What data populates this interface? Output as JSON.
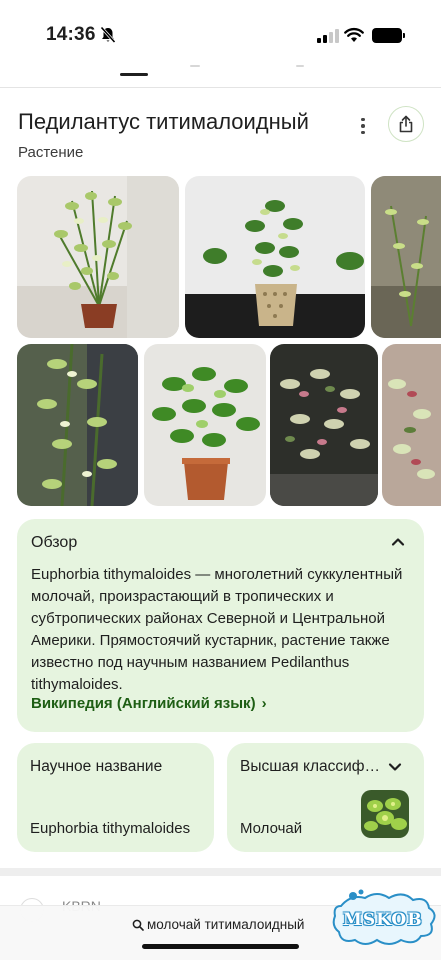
{
  "status_bar": {
    "time": "14:36",
    "accent": "#000000"
  },
  "knowledge_panel": {
    "title": "Педилантус титималоидный",
    "subtitle": "Растение",
    "more_icon": "more-vert-icon",
    "share_icon": "share-icon",
    "photos_count_visible": 9
  },
  "overview": {
    "heading": "Обзор",
    "text": "Euphorbia tithymaloides — многолетний суккулентный молочай, произрастающий в тропических и субтропических районах Северной и Центральной Америки. Прямостоячий кустарник, растение также известно под научным названием Pedilanthus tithymaloides.",
    "source_link": "Википедия (Английский язык)",
    "source_arrow": "›",
    "card_color": "#e6f4df",
    "link_color": "#1e5e14"
  },
  "info_cards": [
    {
      "label": "Научное название",
      "value": "Euphorbia tithymaloides"
    },
    {
      "label": "Высшая классиф…",
      "value": "Молочай"
    }
  ],
  "next_result": {
    "text": "KBRN"
  },
  "bottom_bar": {
    "query": "молочай титималоидный",
    "search_icon": "search-icon"
  },
  "watermark": {
    "text": "MSKOB"
  }
}
